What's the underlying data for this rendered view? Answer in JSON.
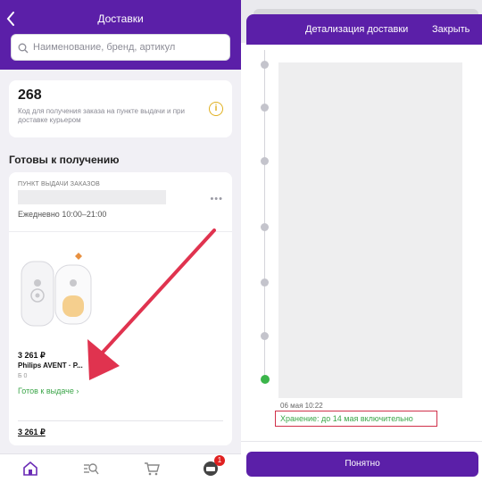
{
  "left": {
    "header": {
      "title": "Доставки",
      "back_icon": "chevron-left-icon",
      "search_placeholder": "Наименование, бренд, артикул"
    },
    "code_card": {
      "code": "268",
      "description": "Код для получения заказа на пункте выдачи и при доставке курьером"
    },
    "section_title": "Готовы к получению",
    "pickup": {
      "label": "ПУНКТ ВЫДАЧИ ЗАКАЗОВ",
      "hours": "Ежедневно 10:00–21:00",
      "more": "•••"
    },
    "product": {
      "price": "3 261 ₽",
      "name": "Philips AVENT · P...",
      "size": "0",
      "size_prefix": "Б",
      "status": "Готов к выдаче ›"
    },
    "total": "3 261 ₽",
    "nav": {
      "items": [
        "home-icon",
        "catalog-search-icon",
        "cart-icon",
        "profile-icon"
      ],
      "badge": "1"
    }
  },
  "right": {
    "title": "Детализация доставки",
    "close_label": "Закрыть",
    "date": "06 мая 10:22",
    "storage": "Хранение: до 14 мая включительно",
    "ok_button": "Понятно"
  },
  "colors": {
    "brand": "#5b1fa8",
    "success": "#3aa548",
    "highlight": "#d0304a",
    "arrow": "#e0334f"
  }
}
